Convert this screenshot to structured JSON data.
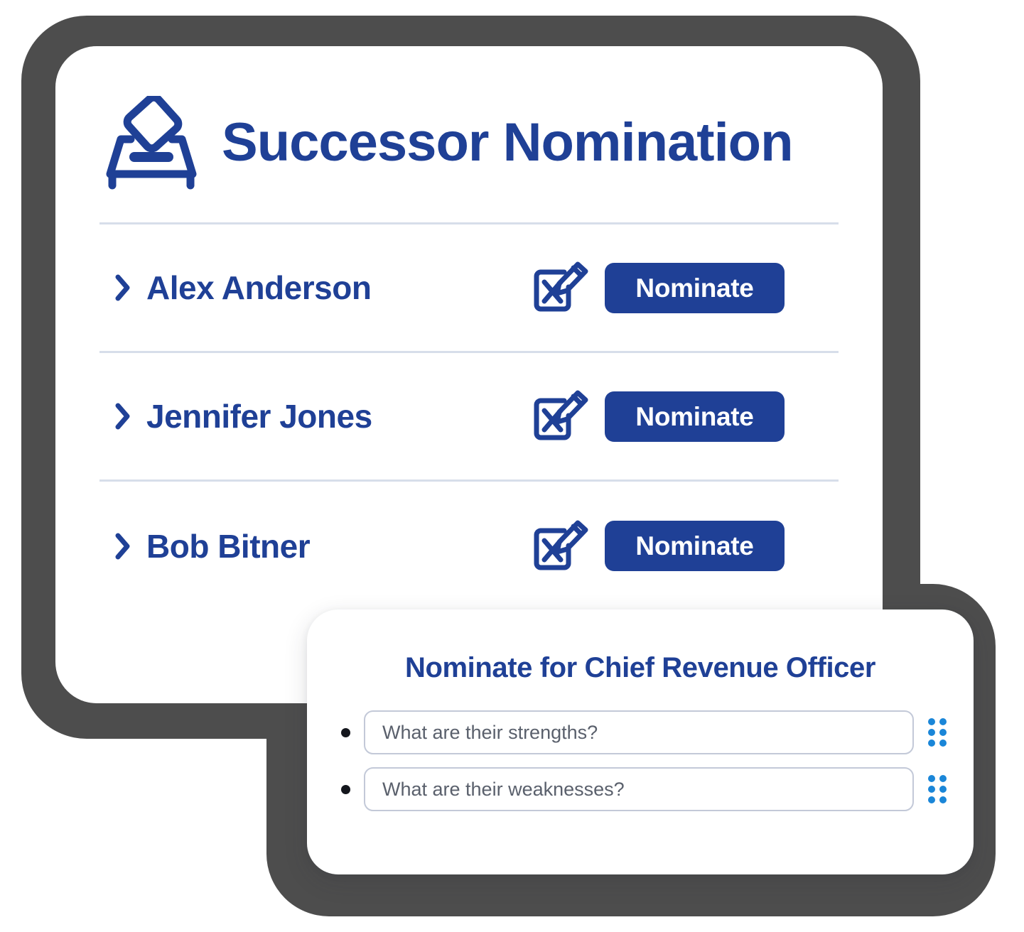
{
  "app": {
    "title": "Successor Nomination",
    "icon": "ballot-box-icon",
    "accent_color": "#1f4096",
    "frame_color": "#4d4d4d",
    "divider_color": "#d7deea"
  },
  "people": [
    {
      "name": "Alex Anderson",
      "expand_icon": "chevron-right-icon",
      "edit_icon": "checkbox-pencil-icon",
      "action_label": "Nominate"
    },
    {
      "name": "Jennifer Jones",
      "expand_icon": "chevron-right-icon",
      "edit_icon": "checkbox-pencil-icon",
      "action_label": "Nominate"
    },
    {
      "name": "Bob Bitner",
      "expand_icon": "chevron-right-icon",
      "edit_icon": "checkbox-pencil-icon",
      "action_label": "Nominate"
    }
  ],
  "modal": {
    "title": "Nominate for Chief Revenue Officer",
    "handle_color": "#1a86d8",
    "fields": [
      {
        "placeholder": "What are their strengths?",
        "value": "",
        "bullet": "bullet-point",
        "handle_icon": "drag-handle-icon"
      },
      {
        "placeholder": "What are their weaknesses?",
        "value": "",
        "bullet": "bullet-point",
        "handle_icon": "drag-handle-icon"
      }
    ]
  }
}
